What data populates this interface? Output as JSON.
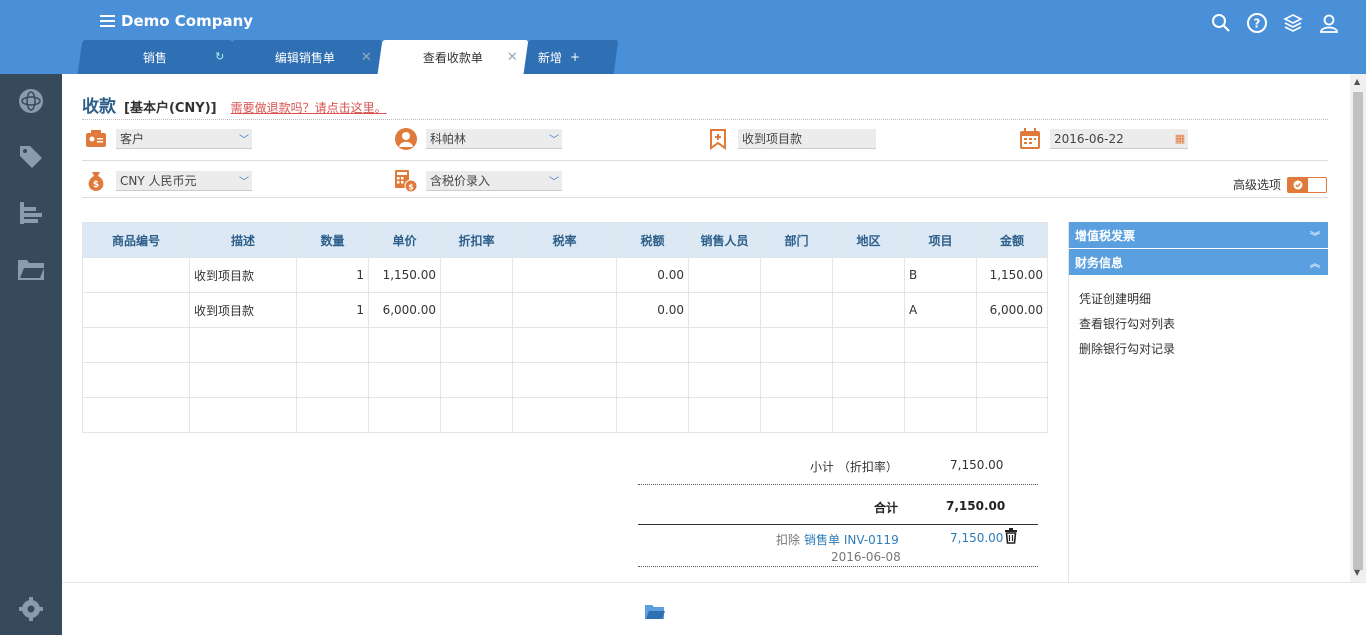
{
  "app": {
    "title": "Demo Company"
  },
  "tabs": [
    {
      "label": "销售"
    },
    {
      "label": "编辑销售单"
    },
    {
      "label": "查看收款单"
    },
    {
      "label": "新增"
    }
  ],
  "header": {
    "title": "收款",
    "account": "[基本户(CNY)]",
    "refund_link": "需要做退款吗？请点击这里。"
  },
  "form": {
    "customer_placeholder": "客户",
    "contact": "科帕林",
    "reference": "收到项目款",
    "date": "2016-06-22",
    "currency": "CNY 人民币元",
    "tax_mode": "含税价录入",
    "advanced_label": "高级选项"
  },
  "table": {
    "columns": [
      "商品编号",
      "描述",
      "数量",
      "单价",
      "折扣率",
      "税率",
      "税额",
      "销售人员",
      "部门",
      "地区",
      "项目",
      "金额"
    ],
    "rows": [
      {
        "code": "",
        "desc": "收到项目款",
        "qty": "1",
        "price": "1,150.00",
        "disc": "",
        "taxrate": "",
        "tax": "0.00",
        "sales": "",
        "dept": "",
        "region": "",
        "project": "B",
        "amount": "1,150.00"
      },
      {
        "code": "",
        "desc": "收到项目款",
        "qty": "1",
        "price": "6,000.00",
        "disc": "",
        "taxrate": "",
        "tax": "0.00",
        "sales": "",
        "dept": "",
        "region": "",
        "project": "A",
        "amount": "6,000.00"
      }
    ]
  },
  "totals": {
    "subtotal_label": "小计 （折扣率）",
    "subtotal_value": "7,150.00",
    "total_label": "合计",
    "total_value": "7,150.00",
    "deduct_label": "扣除",
    "deduct_link": "销售单 INV-0119",
    "deduct_value": "7,150.00",
    "deduct_date": "2016-06-08"
  },
  "right_panel": {
    "vat_header": "增值税发票",
    "finance_header": "财务信息",
    "items": [
      "凭证创建明细",
      "查看银行勾对列表",
      "删除银行勾对记录"
    ]
  },
  "colors": {
    "topbar": "#4a90d9",
    "sidebar": "#364a5c",
    "accent_orange": "#e07a3a"
  }
}
